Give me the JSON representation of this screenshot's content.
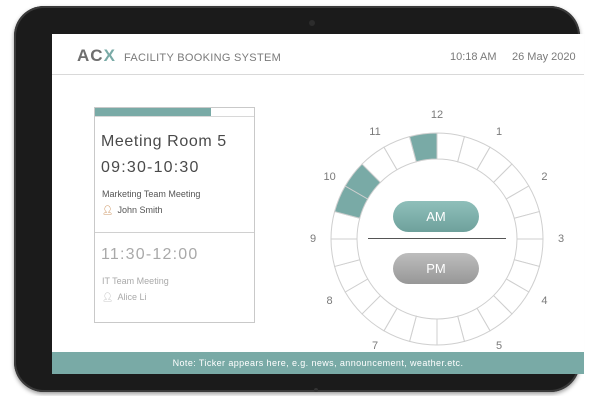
{
  "header": {
    "logo": "ACX",
    "title": "FACILITY BOOKING SYSTEM",
    "time": "10:18 AM",
    "date": "26 May 2020"
  },
  "colors": {
    "accent": "#79aaa6",
    "bezel": "#1b1b1b",
    "pm_pill": "#a8a8a8"
  },
  "booking": {
    "progress_fraction": 0.73,
    "room": "Meeting Room 5",
    "current": {
      "time": "09:30-10:30",
      "title": "Marketing Team Meeting",
      "person": "John Smith",
      "person_icon": "person-icon"
    },
    "next": {
      "time": "11:30-12:00",
      "title": "IT Team Meeting",
      "person": "Alice Li",
      "person_icon": "person-icon"
    }
  },
  "clock": {
    "hours": [
      "12",
      "1",
      "2",
      "3",
      "4",
      "5",
      "6",
      "7",
      "8",
      "9",
      "10",
      "11"
    ],
    "booked_slots": [
      "9:30-10:30",
      "11:30-12:00"
    ],
    "am_label": "AM",
    "pm_label": "PM",
    "selected_period": "AM"
  },
  "ticker": {
    "text": "Note: Ticker appears here, e.g. news, announcement, weather.etc."
  }
}
